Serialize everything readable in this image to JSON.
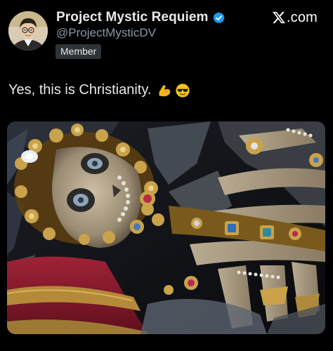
{
  "post": {
    "display_name": "Project Mystic Requiem",
    "handle": "@ProjectMysticDV",
    "badge": "Member",
    "verified": true,
    "text": "Yes, this is Christianity.",
    "emojis": [
      "flexed-biceps",
      "smiling-face-with-sunglasses"
    ]
  },
  "brand": {
    "text": ".com",
    "icon": "x-logo-icon"
  },
  "colors": {
    "background": "#000000",
    "primary_text": "#e7e9ea",
    "secondary_text": "#8b98a5",
    "verified_blue": "#1d9bf0",
    "badge_bg": "#2f3336"
  },
  "media": {
    "kind": "photo",
    "subject": "jeweled-skeleton-image"
  }
}
